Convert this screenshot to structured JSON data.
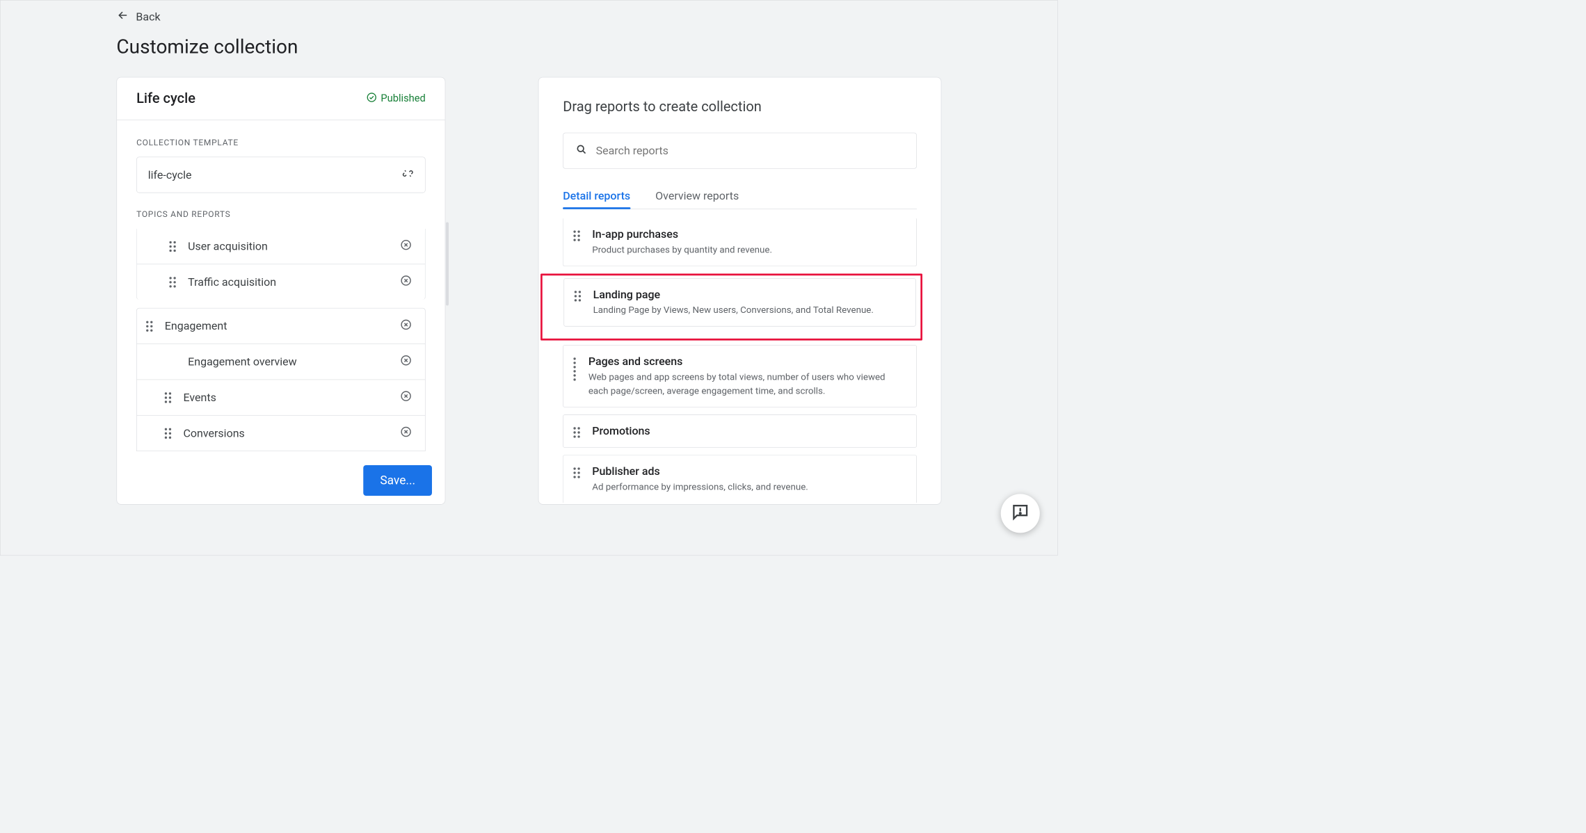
{
  "nav": {
    "back_label": "Back"
  },
  "page_title": "Customize collection",
  "collection": {
    "name": "Life cycle",
    "status_label": "Published",
    "template_section_label": "Collection template",
    "template_value": "life-cycle",
    "topics_section_label": "Topics and reports",
    "acq_reports": [
      "User acquisition",
      "Traffic acquisition"
    ],
    "engagement_topic": "Engagement",
    "engagement_reports": [
      "Engagement overview",
      "Events",
      "Conversions"
    ],
    "save_label": "Save..."
  },
  "right": {
    "title": "Drag reports to create collection",
    "search_placeholder": "Search reports",
    "tabs": {
      "detail": "Detail reports",
      "overview": "Overview reports"
    },
    "reports": [
      {
        "title": "In-app purchases",
        "desc": "Product purchases by quantity and revenue."
      },
      {
        "title": "Landing page",
        "desc": "Landing Page by Views, New users, Conversions, and Total Revenue."
      },
      {
        "title": "Pages and screens",
        "desc": "Web pages and app screens by total views, number of users who viewed each page/screen, average engagement time, and scrolls."
      },
      {
        "title": "Promotions",
        "desc": ""
      },
      {
        "title": "Publisher ads",
        "desc": "Ad performance by impressions, clicks, and revenue."
      }
    ]
  }
}
